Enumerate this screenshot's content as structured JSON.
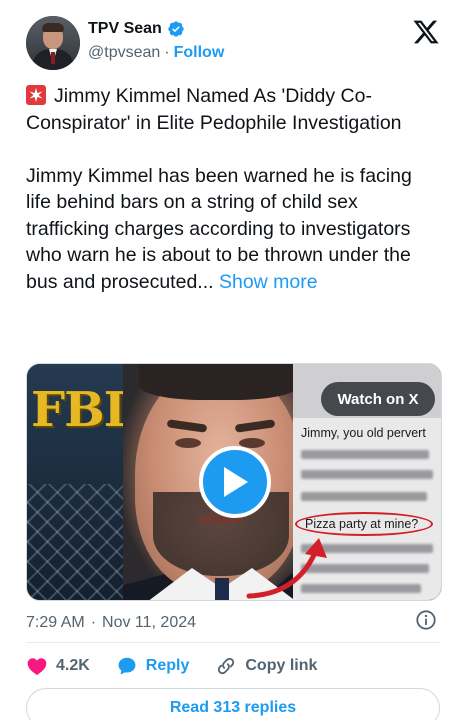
{
  "author": {
    "display_name": "TPV Sean",
    "handle": "@tpvsean",
    "separator": "·",
    "follow_label": "Follow"
  },
  "tweet": {
    "headline": "Jimmy Kimmel Named As 'Diddy Co-Conspirator' in Elite Pedophile Investigation",
    "body": "Jimmy Kimmel has been warned he is facing life behind bars on a string of child sex trafficking charges according to investigators who warn he is about to be thrown under the bus and prosecuted...",
    "show_more_label": "Show more"
  },
  "media": {
    "watch_label": "Watch on X",
    "fbi_text": "FBI",
    "chat_line_1": "Jimmy, you old pervert",
    "chat_line_2": "Pizza party at mine?"
  },
  "meta": {
    "time": "7:29 AM",
    "separator": "·",
    "date": "Nov 11, 2024"
  },
  "actions": {
    "likes_count": "4.2K",
    "reply_label": "Reply",
    "copy_label": "Copy link",
    "read_replies_label": "Read 313 replies"
  },
  "colors": {
    "accent": "#1d9bf0",
    "like": "#f91880",
    "text_primary": "#0f1419",
    "text_secondary": "#536471"
  },
  "icons": [
    "verified-badge-icon",
    "x-logo-icon",
    "siren-emoji-icon",
    "play-icon",
    "info-icon",
    "heart-icon",
    "reply-bubble-icon",
    "link-icon"
  ]
}
